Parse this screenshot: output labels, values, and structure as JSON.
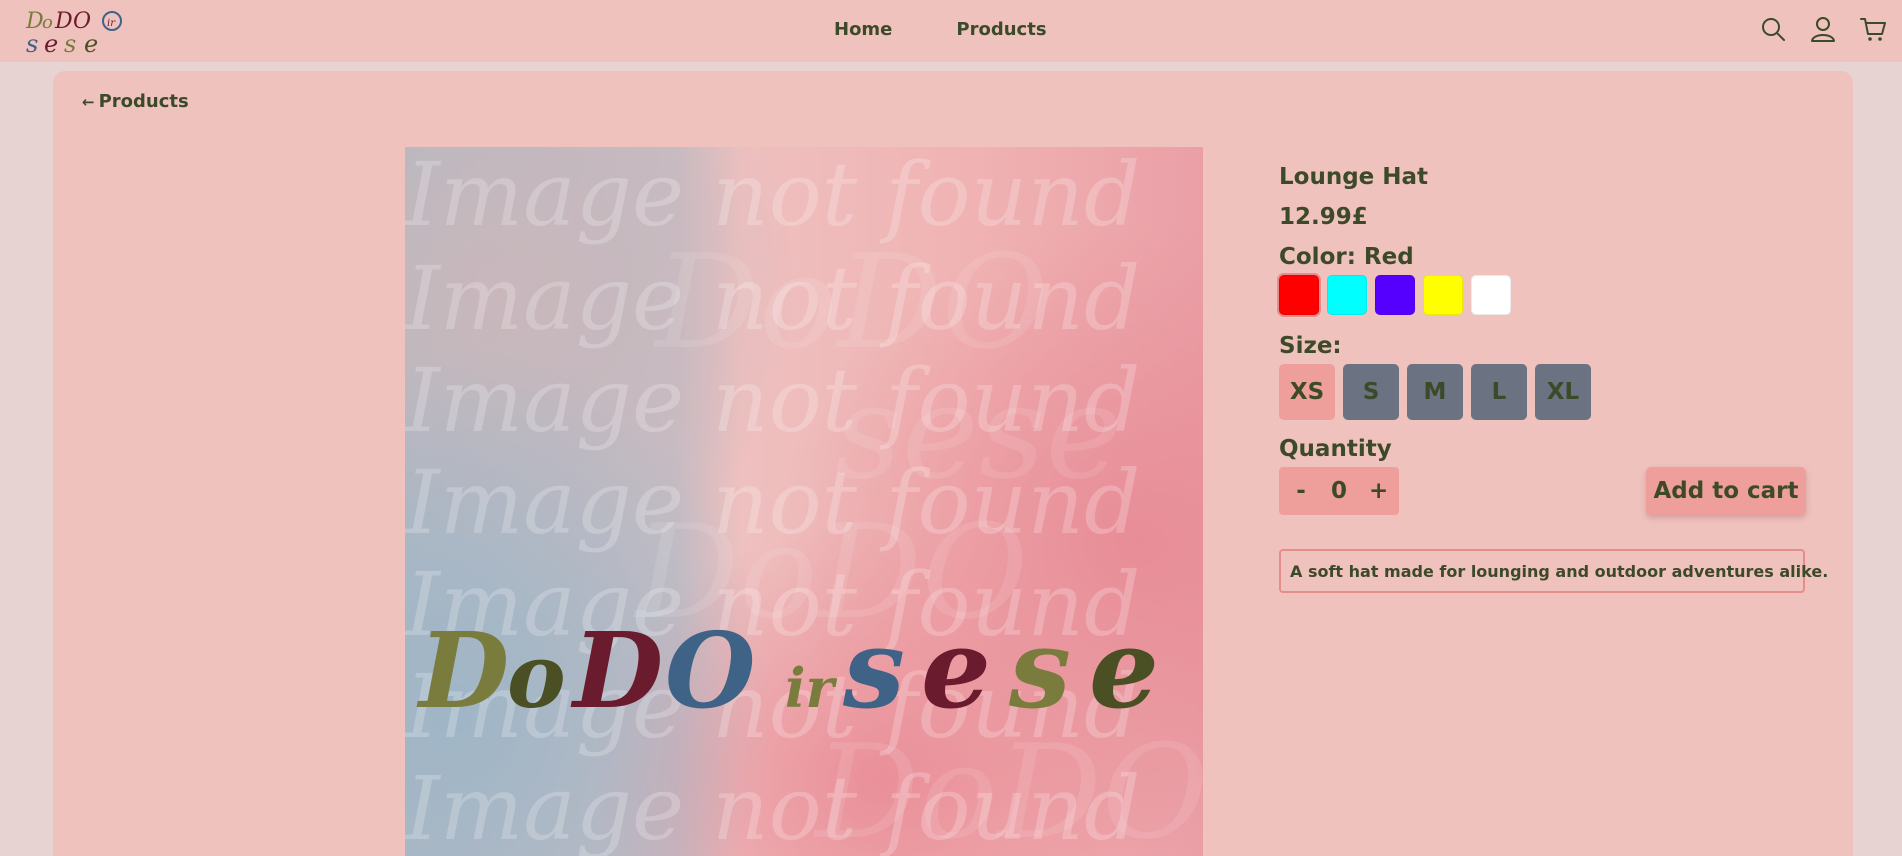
{
  "header": {
    "logo": {
      "text": "DoDO ir sese",
      "colors": [
        "#7a7c3e",
        "#6b1b2e",
        "#3f6287"
      ]
    },
    "nav": [
      {
        "label": "Home"
      },
      {
        "label": "Products"
      }
    ],
    "icons": [
      "search-icon",
      "user-icon",
      "cart-icon"
    ]
  },
  "main": {
    "back_label": "Products",
    "back_icon": "←",
    "image": {
      "watermark_text": "Image not found",
      "brand_text": "DoDO ir sese",
      "brand_colors": [
        "#7a7c3e",
        "#4a4f24",
        "#6b1b2e",
        "#3f6287",
        "#7a7c3e",
        "#3f6287",
        "#6b1b2e",
        "#7a7c3e",
        "#4a4f24"
      ]
    },
    "product": {
      "title": "Lounge Hat",
      "price": "12.99£",
      "color_label": "Color: Red",
      "colors": [
        {
          "name": "Red",
          "hex": "#ff0000",
          "selected": true
        },
        {
          "name": "Cyan",
          "hex": "#00ffff",
          "selected": false
        },
        {
          "name": "Purple",
          "hex": "#5500ff",
          "selected": false
        },
        {
          "name": "Yellow",
          "hex": "#ffff00",
          "selected": false
        },
        {
          "name": "White",
          "hex": "#ffffff",
          "selected": false
        }
      ],
      "size_label": "Size:",
      "sizes": [
        {
          "label": "XS",
          "selected": true
        },
        {
          "label": "S",
          "selected": false
        },
        {
          "label": "M",
          "selected": false
        },
        {
          "label": "L",
          "selected": false
        },
        {
          "label": "XL",
          "selected": false
        }
      ],
      "quantity_label": "Quantity",
      "quantity": {
        "minus": "-",
        "value": "0",
        "plus": "+"
      },
      "add_to_cart_label": "Add to cart",
      "description": "A soft hat made for lounging and outdoor adventures alike."
    }
  },
  "theme": {
    "background": "#e8d3d3",
    "panel": "#f0c2bd",
    "accent": "#ee9f9b",
    "text": "#3d4a2a",
    "size_btn": "#6b7382"
  }
}
